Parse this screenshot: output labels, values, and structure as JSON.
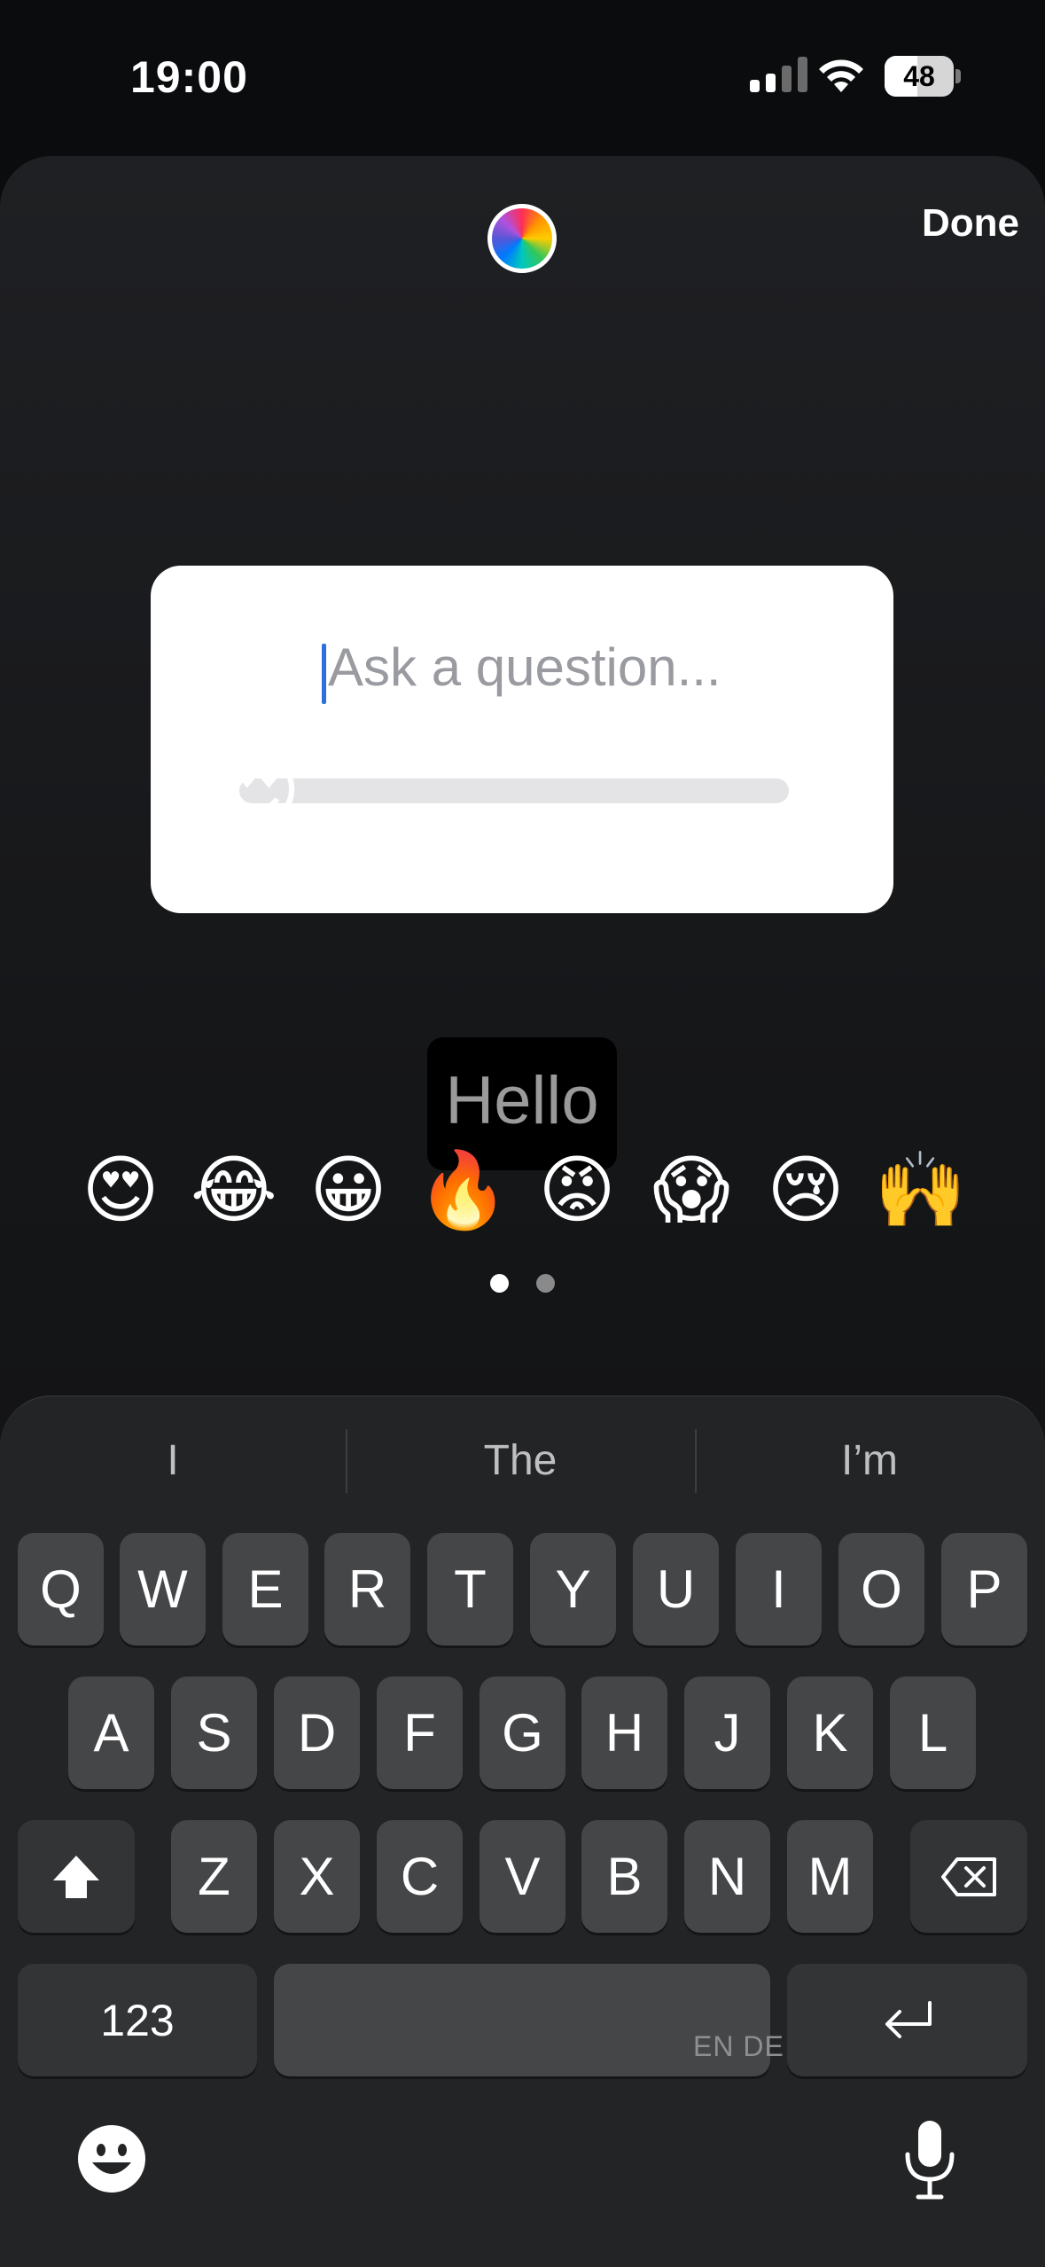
{
  "status_bar": {
    "time": "19:00",
    "battery_level": "48",
    "battery_fraction": 0.48
  },
  "editor": {
    "done_label": "Done",
    "question_placeholder": "Ask a question...",
    "slider_emoji": "😍",
    "text_sticker": "Hello"
  },
  "emoji_picker": {
    "emojis": [
      "😍",
      "😂",
      "😀",
      "🔥",
      "😡",
      "😱",
      "😢",
      "🙌"
    ],
    "page_count": 2,
    "active_page": 0
  },
  "keyboard": {
    "predictions": [
      "I",
      "The",
      "I’m"
    ],
    "row1": [
      "Q",
      "W",
      "E",
      "R",
      "T",
      "Y",
      "U",
      "I",
      "O",
      "P"
    ],
    "row2": [
      "A",
      "S",
      "D",
      "F",
      "G",
      "H",
      "J",
      "K",
      "L"
    ],
    "row3": [
      "Z",
      "X",
      "C",
      "V",
      "B",
      "N",
      "M"
    ],
    "numbers_label": "123",
    "space_language": "EN DE",
    "icons": {
      "shift": "shift-icon",
      "backspace": "backspace-icon",
      "return": "return-icon",
      "emoji": "emoji-face-icon",
      "mic": "microphone-icon"
    }
  }
}
